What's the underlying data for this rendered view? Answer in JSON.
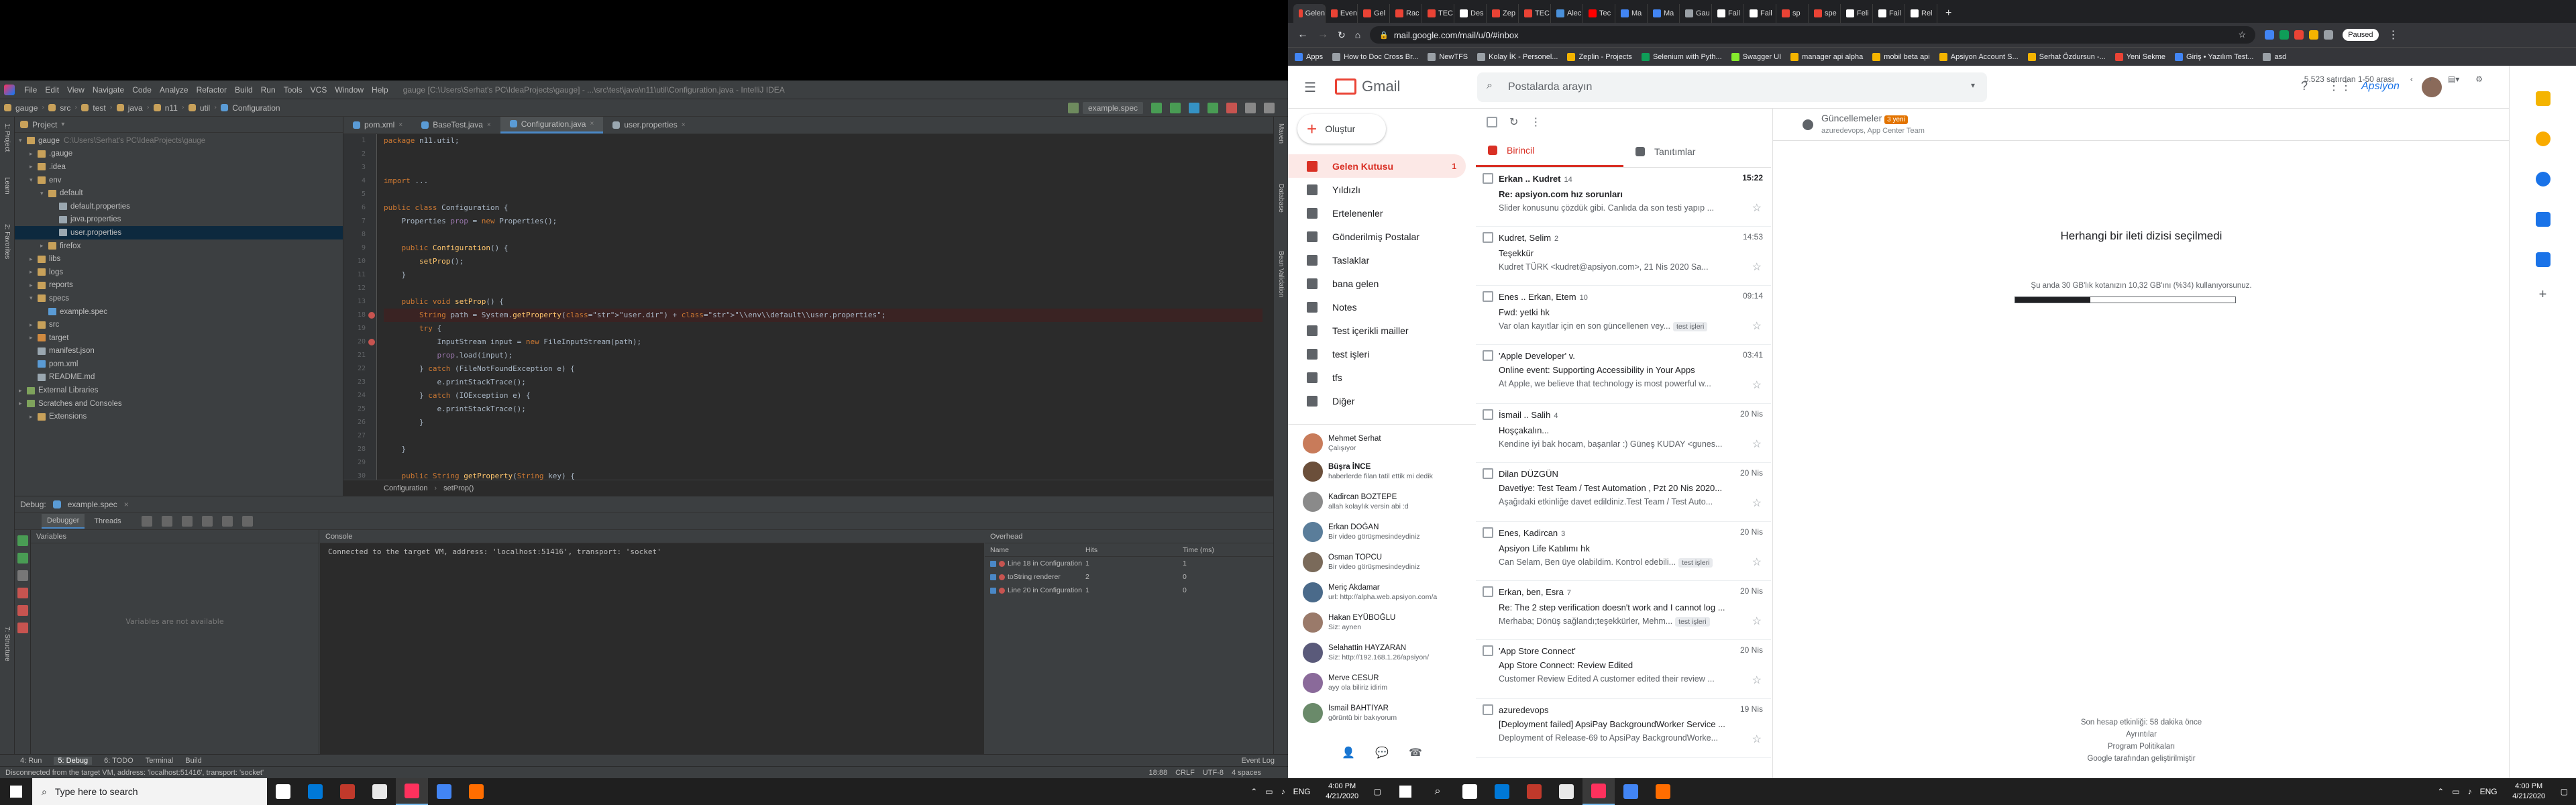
{
  "ide": {
    "title_text": "gauge [C:\\Users\\Serhat's PC\\IdeaProjects\\gauge] - ...\\src\\test\\java\\n11\\util\\Configuration.java - IntelliJ IDEA",
    "menu": [
      "File",
      "Edit",
      "View",
      "Navigate",
      "Code",
      "Analyze",
      "Refactor",
      "Build",
      "Run",
      "Tools",
      "VCS",
      "Window",
      "Help"
    ],
    "breadcrumbs": [
      "gauge",
      "src",
      "test",
      "java",
      "n11",
      "util",
      "Configuration"
    ],
    "run_config": "example.spec",
    "project_label": "Project",
    "tree": [
      {
        "label": "gauge",
        "dim": "C:\\Users\\Serhat's PC\\IdeaProjects\\gauge",
        "level": 0,
        "arrow": "▾",
        "color": "#c8a15a"
      },
      {
        "label": ".gauge",
        "dim": "",
        "level": 1,
        "arrow": "▸",
        "color": "#c8a15a"
      },
      {
        "label": ".idea",
        "dim": "",
        "level": 1,
        "arrow": "▸",
        "color": "#c8a15a"
      },
      {
        "label": "env",
        "dim": "",
        "level": 1,
        "arrow": "▾",
        "color": "#c8a15a"
      },
      {
        "label": "default",
        "dim": "",
        "level": 2,
        "arrow": "▾",
        "color": "#c8a15a"
      },
      {
        "label": "default.properties",
        "dim": "",
        "level": 3,
        "arrow": "",
        "color": "#9aa7b0"
      },
      {
        "label": "java.properties",
        "dim": "",
        "level": 3,
        "arrow": "",
        "color": "#9aa7b0"
      },
      {
        "label": "user.properties",
        "dim": "",
        "level": 3,
        "arrow": "",
        "color": "#9aa7b0",
        "sel": true
      },
      {
        "label": "firefox",
        "dim": "",
        "level": 2,
        "arrow": "▸",
        "color": "#c8a15a"
      },
      {
        "label": "libs",
        "dim": "",
        "level": 1,
        "arrow": "▸",
        "color": "#c8a15a"
      },
      {
        "label": "logs",
        "dim": "",
        "level": 1,
        "arrow": "▸",
        "color": "#c8a15a"
      },
      {
        "label": "reports",
        "dim": "",
        "level": 1,
        "arrow": "▸",
        "color": "#c8a15a"
      },
      {
        "label": "specs",
        "dim": "",
        "level": 1,
        "arrow": "▾",
        "color": "#c8a15a"
      },
      {
        "label": "example.spec",
        "dim": "",
        "level": 2,
        "arrow": "",
        "color": "#5a9bd5"
      },
      {
        "label": "src",
        "dim": "",
        "level": 1,
        "arrow": "▸",
        "color": "#c8a15a"
      },
      {
        "label": "target",
        "dim": "",
        "level": 1,
        "arrow": "▸",
        "color": "#d08a40"
      },
      {
        "label": "manifest.json",
        "dim": "",
        "level": 1,
        "arrow": "",
        "color": "#9aa7b0"
      },
      {
        "label": "pom.xml",
        "dim": "",
        "level": 1,
        "arrow": "",
        "color": "#5a9bd5"
      },
      {
        "label": "README.md",
        "dim": "",
        "level": 1,
        "arrow": "",
        "color": "#9aa7b0"
      },
      {
        "label": "External Libraries",
        "dim": "",
        "level": 0,
        "arrow": "▸",
        "color": "#7fa35c"
      },
      {
        "label": "Scratches and Consoles",
        "dim": "",
        "level": 0,
        "arrow": "▸",
        "color": "#7fa35c"
      },
      {
        "label": "Extensions",
        "dim": "",
        "level": 1,
        "arrow": "▸",
        "color": "#c8a15a"
      }
    ],
    "tabs": [
      {
        "label": "pom.xml",
        "active": false,
        "color": "#5a9bd5"
      },
      {
        "label": "BaseTest.java",
        "active": false,
        "color": "#5a9bd5"
      },
      {
        "label": "Configuration.java",
        "active": true,
        "color": "#5a9bd5"
      },
      {
        "label": "user.properties",
        "active": false,
        "color": "#9aa7b0"
      }
    ],
    "code": [
      {
        "n": "1",
        "t": "package n11.util;",
        "k": "pkg"
      },
      {
        "n": "2",
        "t": "",
        "k": ""
      },
      {
        "n": "3",
        "t": "",
        "k": ""
      },
      {
        "n": "4",
        "t": "import ...",
        "k": "imp"
      },
      {
        "n": "5",
        "t": "",
        "k": ""
      },
      {
        "n": "6",
        "t": "public class Configuration {",
        "k": "cls"
      },
      {
        "n": "7",
        "t": "    Properties prop = new Properties();",
        "k": "fld"
      },
      {
        "n": "8",
        "t": "",
        "k": ""
      },
      {
        "n": "9",
        "t": "    public Configuration() {",
        "k": "ctor"
      },
      {
        "n": "10",
        "t": "        setProp();",
        "k": ""
      },
      {
        "n": "11",
        "t": "    }",
        "k": ""
      },
      {
        "n": "12",
        "t": "",
        "k": ""
      },
      {
        "n": "13",
        "t": "    public void setProp() {",
        "k": "meth"
      },
      {
        "n": "18",
        "t": "        String path = System.getProperty(\"user.dir\") + \"\\\\env\\\\default\\\\user.properties\";",
        "k": "err",
        "bp": true
      },
      {
        "n": "19",
        "t": "        try {",
        "k": "try"
      },
      {
        "n": "20",
        "t": "            InputStream input = new FileInputStream(path);",
        "k": "",
        "bp": true
      },
      {
        "n": "21",
        "t": "            prop.load(input);",
        "k": ""
      },
      {
        "n": "22",
        "t": "        } catch (FileNotFoundException e) {",
        "k": "catch"
      },
      {
        "n": "23",
        "t": "            e.printStackTrace();",
        "k": ""
      },
      {
        "n": "24",
        "t": "        } catch (IOException e) {",
        "k": "catch"
      },
      {
        "n": "25",
        "t": "            e.printStackTrace();",
        "k": ""
      },
      {
        "n": "26",
        "t": "        }",
        "k": ""
      },
      {
        "n": "27",
        "t": "",
        "k": ""
      },
      {
        "n": "28",
        "t": "    }",
        "k": ""
      },
      {
        "n": "29",
        "t": "",
        "k": ""
      },
      {
        "n": "30",
        "t": "    public String getProperty(String key) {",
        "k": "meth"
      }
    ],
    "ed_breadcrumb": [
      "Configuration",
      "setProp()"
    ],
    "debug": {
      "label": "Debug:",
      "config": "example.spec",
      "tabs": [
        "Debugger",
        "Threads"
      ],
      "variables_label": "Variables",
      "variables_empty": "Variables are not available",
      "console_label": "Console",
      "console_text": "Connected to the target VM, address: 'localhost:51416', transport: 'socket'",
      "overhead_label": "Overhead",
      "overhead_cols": [
        "Name",
        "Hits",
        "Time (ms)"
      ],
      "overhead_rows": [
        {
          "name": "Line 18 in Configuration",
          "hits": "1",
          "time": "1"
        },
        {
          "name": "toString renderer",
          "hits": "2",
          "time": "0"
        },
        {
          "name": "Line 20 in Configuration",
          "hits": "1",
          "time": "0"
        }
      ]
    },
    "bottom_tabs": [
      "4: Run",
      "5: Debug",
      "6: TODO",
      "Terminal",
      "Build"
    ],
    "event_log": "Event Log",
    "status_text": "Disconnected from the target VM, address: 'localhost:51416', transport: 'socket'",
    "status_right": [
      "18:88",
      "CRLF",
      "UTF-8",
      "4 spaces"
    ]
  },
  "chrome": {
    "tabs": [
      "Gelen",
      "Even",
      "Gel",
      "Rac",
      "TEC",
      "Des",
      "Zep",
      "TEC",
      "Alec",
      "Tec",
      "Ma",
      "Ma",
      "Gau",
      "Fail",
      "Fail",
      "sp",
      "spe",
      "Feli",
      "Fail",
      "Rel"
    ],
    "tab_colors": [
      "#ea4335",
      "#ea4335",
      "#ea4335",
      "#ea4335",
      "#ea4335",
      "#ffffff",
      "#ea4335",
      "#ea4335",
      "#4a90d9",
      "#ff0000",
      "#4285f4",
      "#4285f4",
      "#9aa0a6",
      "#ffffff",
      "#ffffff",
      "#ea4335",
      "#ea4335",
      "#ffffff",
      "#ffffff",
      "#ffffff"
    ],
    "url": "mail.google.com/mail/u/0/#inbox",
    "profile": "Paused",
    "bookmarks": [
      "Apps",
      "How to Doc Cross Br...",
      "NewTFS",
      "Kolay İK - Personel...",
      "Zeplin - Projects",
      "Selenium with Pyth...",
      "Swagger UI",
      "manager api alpha",
      "mobil beta api",
      "Apsiyon Account S...",
      "Serhat Özdursun -...",
      "Yeni Sekme",
      "Giriş • Yazılım Test...",
      "asd"
    ],
    "bookmark_colors": [
      "#4285f4",
      "#9aa0a6",
      "#9aa0a6",
      "#9aa0a6",
      "#f4b400",
      "#0f9d58",
      "#85ea2d",
      "#f4b400",
      "#f4b400",
      "#f4b400",
      "#f4b400",
      "#ea4335",
      "#4285f4",
      "#9aa0a6"
    ]
  },
  "gmail": {
    "logo": "Gmail",
    "search_placeholder": "Postalarda arayın",
    "account": "Apsiyon",
    "compose": "Oluştur",
    "nav": [
      {
        "label": "Gelen Kutusu",
        "count": "1",
        "active": true
      },
      {
        "label": "Yıldızlı",
        "count": "",
        "active": false
      },
      {
        "label": "Ertelenenler",
        "count": "",
        "active": false
      },
      {
        "label": "Gönderilmiş Postalar",
        "count": "",
        "active": false
      },
      {
        "label": "Taslaklar",
        "count": "",
        "active": false
      },
      {
        "label": "bana gelen",
        "count": "",
        "active": false
      },
      {
        "label": "Notes",
        "count": "",
        "active": false
      },
      {
        "label": "Test içerikli mailler",
        "count": "",
        "active": false
      },
      {
        "label": "test işleri",
        "count": "",
        "active": false
      },
      {
        "label": "tfs",
        "count": "",
        "active": false
      },
      {
        "label": "Diğer",
        "count": "",
        "active": false
      }
    ],
    "hangouts": [
      {
        "name": "Mehmet Serhat",
        "sub": "Çalışıyor",
        "color": "#c87b5a"
      },
      {
        "name": "Büşra İNCE",
        "sub": "haberlerde filan tatil ettik mi dedik",
        "color": "#6b4f3a"
      },
      {
        "name": "Kadircan BOZTEPE",
        "sub": "allah kolaylık versin abi :d",
        "color": "#8a8a8a"
      },
      {
        "name": "Erkan DOĞAN",
        "sub": "Bir video görüşmesindeydiniz",
        "color": "#5a7d9a"
      },
      {
        "name": "Osman TOPCU",
        "sub": "Bir video görüşmesindeydiniz",
        "color": "#7a6a5a"
      },
      {
        "name": "Meriç Akdamar",
        "sub": "url: http://alpha.web.apsiyon.com/a",
        "color": "#4a6a8a"
      },
      {
        "name": "Hakan EYÜBOĞLU",
        "sub": "Siz: aynen",
        "color": "#9a7a6a"
      },
      {
        "name": "Selahattin HAYZARAN",
        "sub": "Siz: http://192.168.1.26/apsiyon/",
        "color": "#5a5a7a"
      },
      {
        "name": "Merve CESUR",
        "sub": "ayy ola biliriz idirim",
        "color": "#8a6a9a"
      },
      {
        "name": "İsmail BAHTİYAR",
        "sub": "görüntü bir bakıyorum",
        "color": "#6a8a6a"
      }
    ],
    "page_info": "5.523 satırdan 1-50 arası",
    "cats": [
      {
        "label": "Birincil",
        "active": true
      },
      {
        "label": "Tanıtımlar",
        "active": false
      },
      {
        "label": "Güncellemeler",
        "active": false,
        "badge": "3 yeni",
        "sub": "azuredevops, App Center Team"
      }
    ],
    "mails": [
      {
        "sender": "Erkan .. Kudret",
        "num": "14",
        "subject": "Re: apsiyon.com hız sorunları",
        "snippet": "Slider konusunu çözdük gibi. Canlıda da son testi yapıp ...",
        "date": "15:22",
        "unread": true,
        "tag": ""
      },
      {
        "sender": "Kudret, Selim",
        "num": "2",
        "subject": "Teşekkür",
        "snippet": "Kudret TÜRK <kudret@apsiyon.com>, 21 Nis 2020 Sa...",
        "date": "14:53",
        "unread": false,
        "tag": ""
      },
      {
        "sender": "Enes .. Erkan, Etem",
        "num": "10",
        "subject": "Fwd: yetki hk",
        "snippet": "Var olan kayıtlar için en son güncellenen vey...",
        "date": "09:14",
        "unread": false,
        "tag": "test işleri"
      },
      {
        "sender": "'Apple Developer' v.",
        "num": "",
        "subject": "Online event: Supporting Accessibility in Your Apps",
        "snippet": "At Apple, we believe that technology is most powerful w...",
        "date": "03:41",
        "unread": false,
        "tag": ""
      },
      {
        "sender": "İsmail .. Salih",
        "num": "4",
        "subject": "Hoşçakalın...",
        "snippet": "Kendine iyi bak hocam, başarılar :) Güneş KUDAY <gunes...",
        "date": "20 Nis",
        "unread": false,
        "tag": ""
      },
      {
        "sender": "Dilan DÜZGÜN",
        "num": "",
        "subject": "Davetiye: Test Team / Test Automation , Pzt 20 Nis 2020...",
        "snippet": "Aşağıdaki etkinliğe davet edildiniz.Test Team / Test Auto...",
        "date": "20 Nis",
        "unread": false,
        "tag": ""
      },
      {
        "sender": "Enes, Kadircan",
        "num": "3",
        "subject": "Apsiyon Life Katılımı hk",
        "snippet": "Can Selam, Ben üye olabildim. Kontrol edebili...",
        "date": "20 Nis",
        "unread": false,
        "tag": "test işleri"
      },
      {
        "sender": "Erkan, ben, Esra",
        "num": "7",
        "subject": "Re: The 2 step verification doesn't work and I cannot log ...",
        "snippet": "Merhaba; Dönüş sağlandı;teşekkürler, Mehm...",
        "date": "20 Nis",
        "unread": false,
        "tag": "test işleri"
      },
      {
        "sender": "'App Store Connect'",
        "num": "",
        "subject": "App Store Connect: Review Edited",
        "snippet": "Customer Review Edited A customer edited their review ...",
        "date": "20 Nis",
        "unread": false,
        "tag": ""
      },
      {
        "sender": "azuredevops",
        "num": "",
        "subject": "[Deployment failed] ApsiPay BackgroundWorker Service ...",
        "snippet": "Deployment of Release-69 to ApsiPay BackgroundWorke...",
        "date": "19 Nis",
        "unread": false,
        "tag": ""
      }
    ],
    "empty_title": "Herhangi bir ileti dizisi seçilmedi",
    "storage_text": "Şu anda 30 GB'lık kotanızın 10,32 GB'ını (%34) kullanıyorsunuz.",
    "storage_fraction": 0.34,
    "footer_activity": "Son hesap etkinliği: 58 dakika önce",
    "footer_details": "Ayrıntılar",
    "footer_policy": "Program Politikaları",
    "footer_google": "Google tarafından geliştirilmiştir"
  },
  "taskbar": {
    "search_placeholder": "Type here to search",
    "time": "4:00 PM",
    "date": "4/21/2020",
    "icons": [
      "#ffffff",
      "#0078d7",
      "#c0392b",
      "#e8e8e8",
      "#fe315d",
      "#4285f4",
      "#ff6d00"
    ]
  }
}
